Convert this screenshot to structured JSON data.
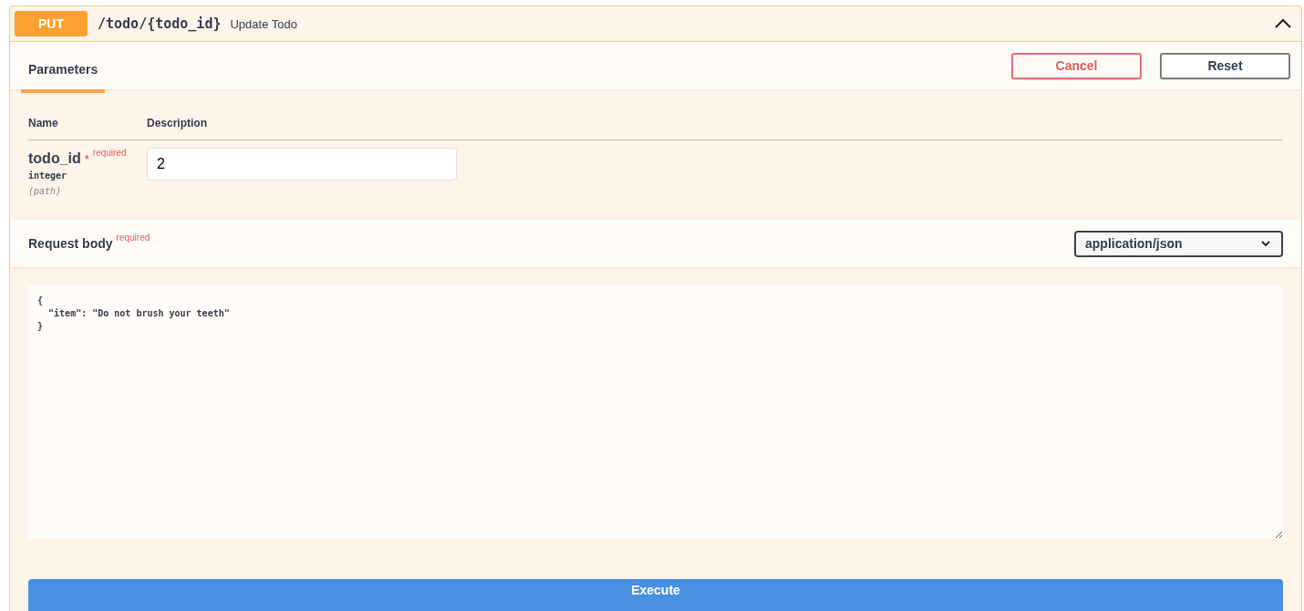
{
  "operation": {
    "method": "PUT",
    "path": "/todo/{todo_id}",
    "summary": "Update Todo",
    "expanded": true
  },
  "tabs": [
    {
      "label": "Parameters",
      "selected": true
    }
  ],
  "buttons": [
    {
      "kind": "cancel",
      "label": "Cancel"
    },
    {
      "kind": "reset",
      "label": "Reset"
    }
  ],
  "parameters": {
    "columns": [
      "Name",
      "Description"
    ],
    "rows": [
      {
        "name": "todo_id",
        "required_mark": "*",
        "required_label": "required",
        "type": "integer",
        "location": "(path)",
        "value": "2"
      }
    ]
  },
  "request_body": {
    "title": "Request body",
    "required_label": "required",
    "content_type": "application/json",
    "value": "{\n  \"item\": \"Do not brush your teeth\"\n}"
  },
  "execute_button": "Execute"
}
